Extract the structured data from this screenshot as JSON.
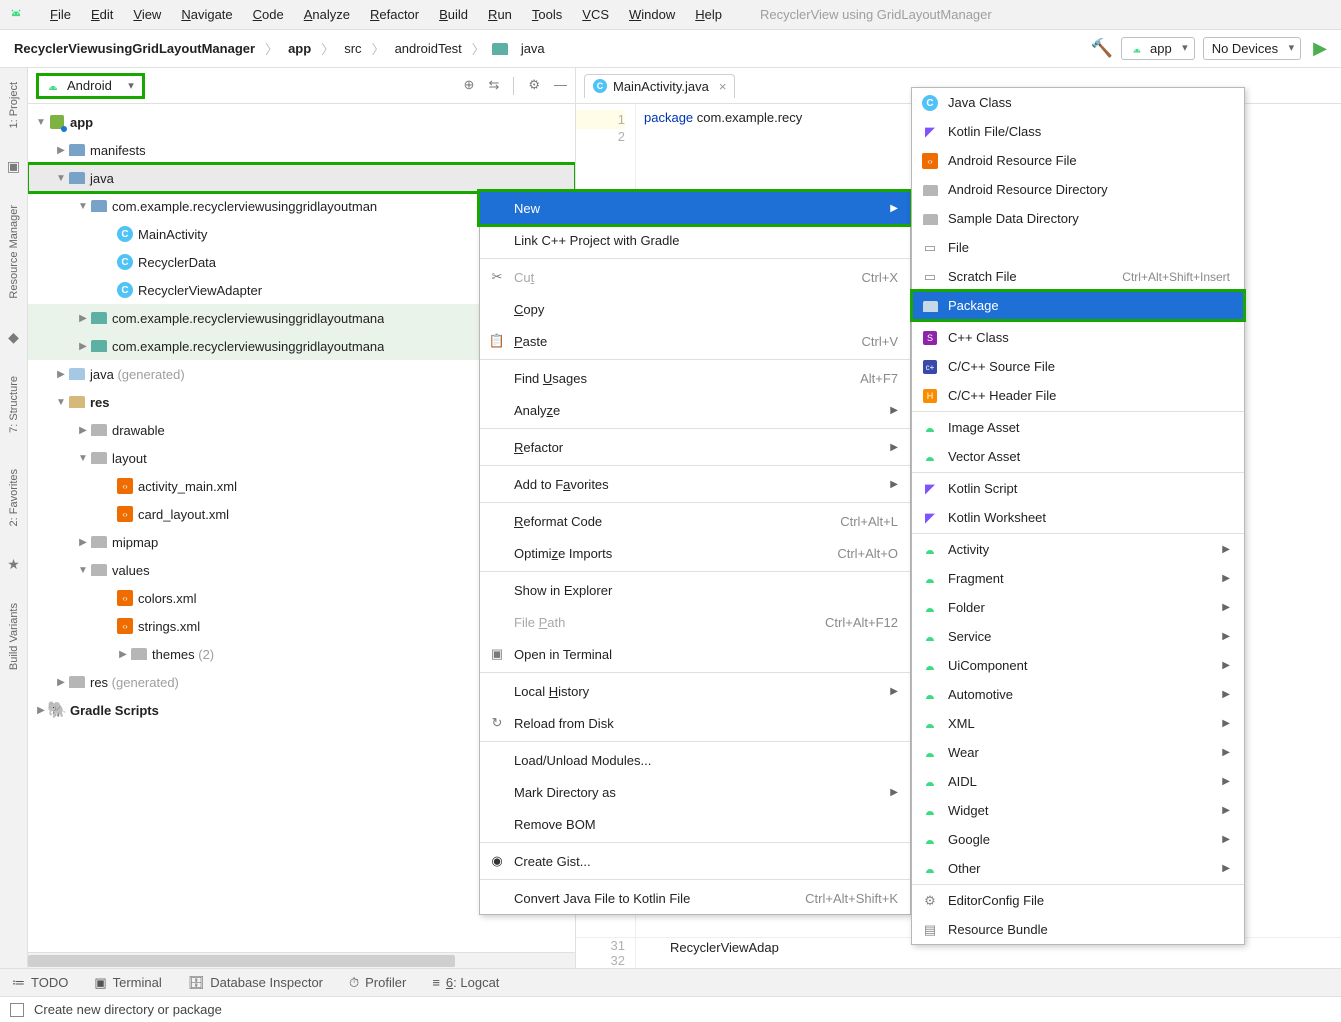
{
  "menubar": {
    "items": [
      "File",
      "Edit",
      "View",
      "Navigate",
      "Code",
      "Analyze",
      "Refactor",
      "Build",
      "Run",
      "Tools",
      "VCS",
      "Window",
      "Help"
    ],
    "hint": "RecyclerView using GridLayoutManager"
  },
  "breadcrumb": {
    "root": "RecyclerViewusingGridLayoutManager",
    "parts": [
      "app",
      "src",
      "androidTest",
      "java"
    ]
  },
  "nav_right": {
    "config": "app",
    "device": "No Devices"
  },
  "panel": {
    "view": "Android"
  },
  "tree": {
    "app": "app",
    "manifests": "manifests",
    "java": "java",
    "pkg1": "com.example.recyclerviewusinggridlayoutman",
    "mainActivity": "MainActivity",
    "recyclerData": "RecyclerData",
    "recyclerAdapter": "RecyclerViewAdapter",
    "pkg2": "com.example.recyclerviewusinggridlayoutmana",
    "pkg3": "com.example.recyclerviewusinggridlayoutmana",
    "javaGen": "java",
    "generated": " (generated)",
    "res": "res",
    "drawable": "drawable",
    "layout": "layout",
    "activityMain": "activity_main.xml",
    "cardLayout": "card_layout.xml",
    "mipmap": "mipmap",
    "values": "values",
    "colors": "colors.xml",
    "strings": "strings.xml",
    "themes": "themes",
    "themesCount": " (2)",
    "resGen": "res",
    "gradle": "Gradle Scripts"
  },
  "editor": {
    "tab": "MainActivity.java",
    "line1": "1",
    "line2": "2",
    "lineN": "31",
    "lineN2": "32",
    "kw": "package",
    "pkg": " com.example.recy",
    "bottomCode": "RecyclerViewAdap"
  },
  "ctx1": {
    "new": "New",
    "link": "Link C++ Project with Gradle",
    "cut": "Cut",
    "cut_s": "Ctrl+X",
    "copy": "Copy",
    "paste": "Paste",
    "paste_s": "Ctrl+V",
    "findUsages": "Find Usages",
    "findUsages_s": "Alt+F7",
    "analyze": "Analyze",
    "refactor": "Refactor",
    "addFav": "Add to Favorites",
    "reformat": "Reformat Code",
    "reformat_s": "Ctrl+Alt+L",
    "optimize": "Optimize Imports",
    "optimize_s": "Ctrl+Alt+O",
    "showExplorer": "Show in Explorer",
    "filePath": "File Path",
    "filePath_s": "Ctrl+Alt+F12",
    "openTerminal": "Open in Terminal",
    "localHistory": "Local History",
    "reload": "Reload from Disk",
    "loadUnload": "Load/Unload Modules...",
    "markDir": "Mark Directory as",
    "removeBOM": "Remove BOM",
    "gist": "Create Gist...",
    "convertKotlin": "Convert Java File to Kotlin File",
    "convertKotlin_s": "Ctrl+Alt+Shift+K"
  },
  "ctx2": {
    "javaClass": "Java Class",
    "kotlinFile": "Kotlin File/Class",
    "ardFile": "Android Resource File",
    "ardDir": "Android Resource Directory",
    "sampleData": "Sample Data Directory",
    "file": "File",
    "scratch": "Scratch File",
    "scratch_s": "Ctrl+Alt+Shift+Insert",
    "package": "Package",
    "cppClass": "C++ Class",
    "cSource": "C/C++ Source File",
    "cHeader": "C/C++ Header File",
    "imageAsset": "Image Asset",
    "vectorAsset": "Vector Asset",
    "kotlinScript": "Kotlin Script",
    "kotlinWorksheet": "Kotlin Worksheet",
    "activity": "Activity",
    "fragment": "Fragment",
    "folder": "Folder",
    "service": "Service",
    "uiComponent": "UiComponent",
    "automotive": "Automotive",
    "xml": "XML",
    "wear": "Wear",
    "aidl": "AIDL",
    "widget": "Widget",
    "google": "Google",
    "other": "Other",
    "editorConfig": "EditorConfig File",
    "resBundle": "Resource Bundle"
  },
  "rails": {
    "project": "1: Project",
    "resmgr": "Resource Manager",
    "structure": "7: Structure",
    "favorites": "2: Favorites",
    "variants": "Build Variants"
  },
  "bottom": {
    "todo": "TODO",
    "terminal": "Terminal",
    "dbinsp": "Database Inspector",
    "profiler": "Profiler",
    "logcat": "6: Logcat"
  },
  "status": "Create new directory or package"
}
